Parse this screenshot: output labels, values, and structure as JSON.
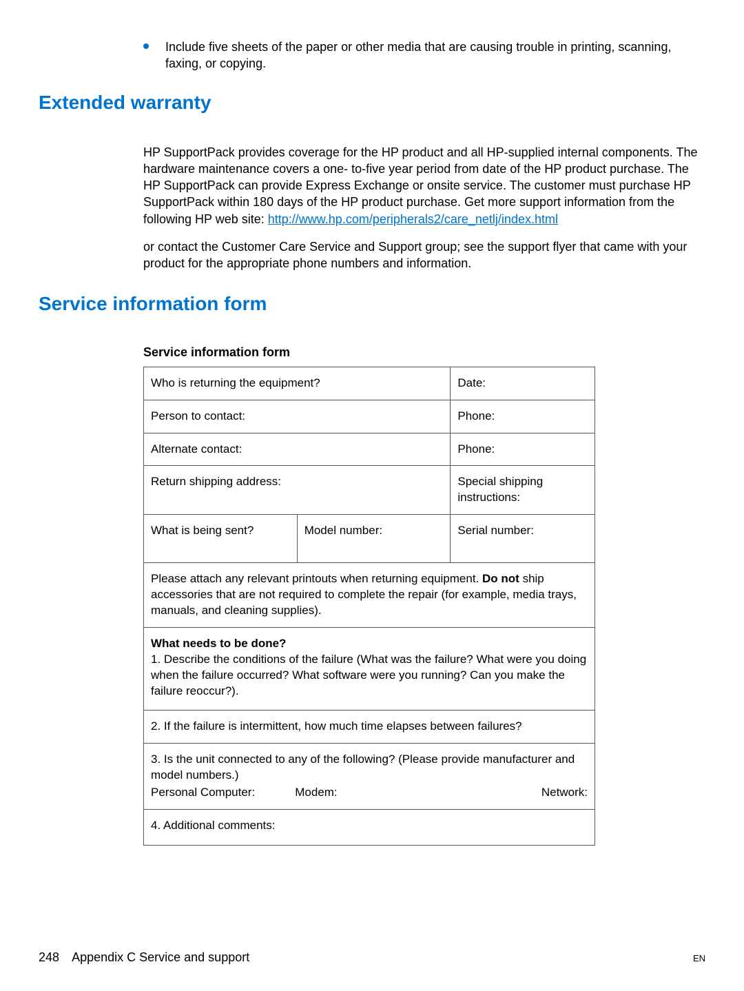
{
  "bullet": "Include five sheets of the paper or other media that are causing trouble in printing, scanning, faxing, or copying.",
  "h_extended": "Extended warranty",
  "para1_pre": "HP SupportPack provides coverage for the HP product and all HP-supplied internal components. The hardware maintenance covers a one- to-five year period from date of the HP product purchase. The HP SupportPack can provide Express Exchange or onsite service. The customer must purchase HP SupportPack within 180 days of the HP product purchase. Get more support information from the following HP web site: ",
  "para1_link": "http://www.hp.com/peripherals2/care_netlj/index.html",
  "para2": "or contact the Customer Care Service and Support group; see the support flyer that came with your product for the appropriate phone numbers and information.",
  "h_service": "Service information form",
  "table_title": "Service information form",
  "form": {
    "who": "Who is returning the equipment?",
    "date": "Date:",
    "person": "Person to contact:",
    "phone1": "Phone:",
    "alt": "Alternate contact:",
    "phone2": "Phone:",
    "return_addr": "Return shipping address:",
    "special": "Special shipping instructions:",
    "what_sent": "What is being sent?",
    "model": "Model number:",
    "serial": "Serial number:",
    "attach_pre": "Please attach any relevant printouts when returning equipment. ",
    "attach_bold": "Do not",
    "attach_post": " ship accessories that are not required to complete the repair (for example, media trays, manuals, and cleaning supplies).",
    "needs_title": "What needs to be done?",
    "needs_1": "1. Describe the conditions of the failure (What was the failure? What were you doing when the failure occurred? What software were you running? Can you make the failure reoccur?).",
    "needs_2": "2. If the failure is intermittent, how much time elapses between failures?",
    "needs_3_intro": "3. Is the unit connected to any of the following? (Please provide manufacturer and model numbers.)",
    "pc": "Personal Computer:",
    "modem": "Modem:",
    "network": "Network:",
    "needs_4": "4. Additional comments:"
  },
  "footer": {
    "page": "248",
    "appendix": "Appendix C Service and support",
    "lang": "EN"
  }
}
